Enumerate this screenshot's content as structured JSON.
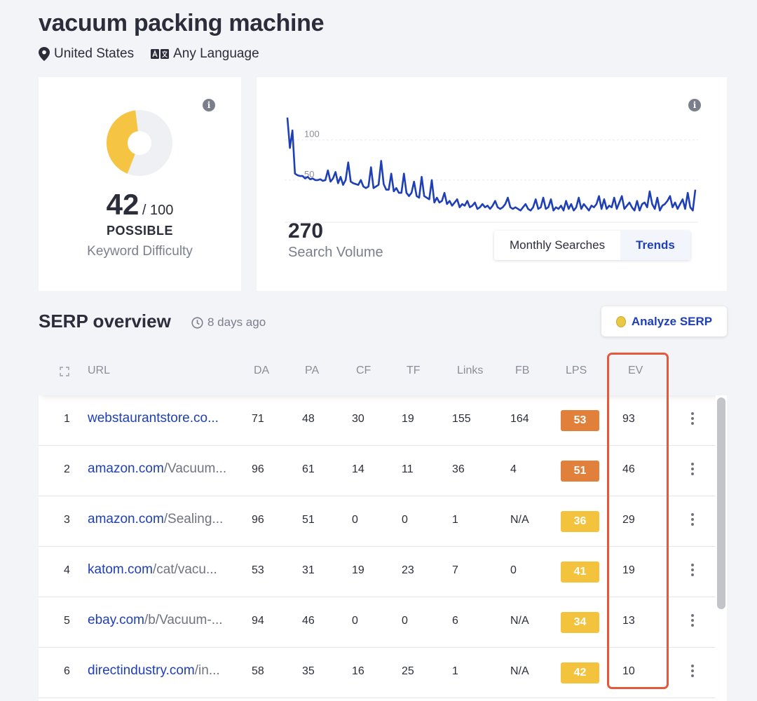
{
  "keyword": "vacuum packing machine",
  "meta": {
    "location": "United States",
    "language": "Any Language"
  },
  "difficulty": {
    "score": "42",
    "out_of": "/ 100",
    "level": "POSSIBLE",
    "label": "Keyword Difficulty",
    "fill_fraction": 0.42,
    "colors": {
      "fill": "#f6c443",
      "track": "#eff0f4"
    }
  },
  "search_volume": {
    "value": "270",
    "label": "Search Volume",
    "toggle": {
      "monthly": "Monthly Searches",
      "trends": "Trends",
      "active": "trends"
    },
    "chart_data": {
      "type": "line",
      "y_ticks": [
        "100",
        "50"
      ],
      "ylim": [
        0,
        140
      ],
      "color": "#1f3fb7",
      "values": [
        128,
        90,
        112,
        58,
        56,
        55,
        55,
        52,
        54,
        51,
        52,
        50,
        50,
        51,
        49,
        50,
        62,
        48,
        52,
        60,
        46,
        54,
        44,
        50,
        72,
        48,
        46,
        45,
        44,
        50,
        42,
        40,
        42,
        66,
        40,
        42,
        44,
        74,
        45,
        38,
        38,
        58,
        36,
        40,
        34,
        34,
        58,
        34,
        30,
        34,
        48,
        30,
        28,
        54,
        30,
        28,
        26,
        50,
        22,
        28,
        22,
        24,
        34,
        20,
        24,
        18,
        22,
        26,
        16,
        20,
        18,
        24,
        16,
        18,
        22,
        14,
        16,
        20,
        16,
        18,
        14,
        18,
        24,
        16,
        14,
        16,
        20,
        28,
        16,
        14,
        16,
        14,
        12,
        16,
        20,
        14,
        12,
        16,
        26,
        14,
        16,
        28,
        14,
        16,
        26,
        12,
        16,
        14,
        18,
        12,
        24,
        14,
        20,
        12,
        16,
        28,
        14,
        20,
        16,
        12,
        18,
        16,
        20,
        30,
        14,
        26,
        14,
        18,
        16,
        28,
        14,
        22,
        30,
        14,
        18,
        22,
        16,
        12,
        24,
        12,
        20,
        22,
        16,
        36,
        20,
        14,
        28,
        12,
        18,
        20,
        24,
        30,
        16,
        22,
        14,
        20,
        26,
        14,
        34,
        16,
        12,
        38
      ]
    }
  },
  "serp": {
    "title": "SERP overview",
    "updated": "8 days ago",
    "analyze_label": "Analyze SERP",
    "columns": [
      "URL",
      "DA",
      "PA",
      "CF",
      "TF",
      "Links",
      "FB",
      "LPS",
      "EV"
    ],
    "lps_colors": {
      "high": "#e0803b",
      "mid": "#f3c33e"
    },
    "rows": [
      {
        "rank": "1",
        "domain": "webstaurantstore.co...",
        "path": "",
        "da": "71",
        "pa": "48",
        "cf": "30",
        "tf": "19",
        "links": "155",
        "fb": "164",
        "lps": "53",
        "lps_tier": "high",
        "ev": "93"
      },
      {
        "rank": "2",
        "domain": "amazon.com",
        "path": "/Vacuum...",
        "da": "96",
        "pa": "61",
        "cf": "14",
        "tf": "11",
        "links": "36",
        "fb": "4",
        "lps": "51",
        "lps_tier": "high",
        "ev": "46"
      },
      {
        "rank": "3",
        "domain": "amazon.com",
        "path": "/Sealing...",
        "da": "96",
        "pa": "51",
        "cf": "0",
        "tf": "0",
        "links": "1",
        "fb": "N/A",
        "lps": "36",
        "lps_tier": "mid",
        "ev": "29"
      },
      {
        "rank": "4",
        "domain": "katom.com",
        "path": "/cat/vacu...",
        "da": "53",
        "pa": "31",
        "cf": "19",
        "tf": "23",
        "links": "7",
        "fb": "0",
        "lps": "41",
        "lps_tier": "mid",
        "ev": "19"
      },
      {
        "rank": "5",
        "domain": "ebay.com",
        "path": "/b/Vacuum-...",
        "da": "94",
        "pa": "46",
        "cf": "0",
        "tf": "0",
        "links": "6",
        "fb": "N/A",
        "lps": "34",
        "lps_tier": "mid",
        "ev": "13"
      },
      {
        "rank": "6",
        "domain": "directindustry.com",
        "path": "/in...",
        "da": "58",
        "pa": "35",
        "cf": "16",
        "tf": "25",
        "links": "1",
        "fb": "N/A",
        "lps": "42",
        "lps_tier": "mid",
        "ev": "10"
      }
    ]
  },
  "highlight_color": "#e25a3b"
}
